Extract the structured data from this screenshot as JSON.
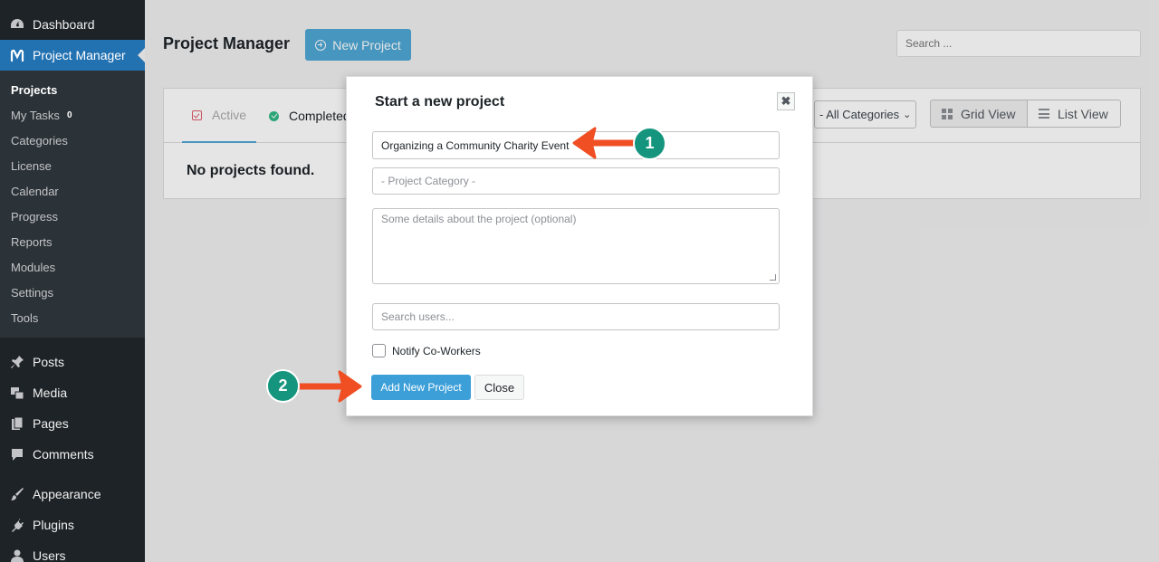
{
  "sidebar": {
    "top": [
      {
        "label": "Dashboard",
        "icon": "dashboard-icon"
      },
      {
        "label": "Project Manager",
        "icon": "project-manager-icon"
      }
    ],
    "submenu": [
      {
        "label": "Projects"
      },
      {
        "label": "My Tasks",
        "badge": "0"
      },
      {
        "label": "Categories"
      },
      {
        "label": "License"
      },
      {
        "label": "Calendar"
      },
      {
        "label": "Progress"
      },
      {
        "label": "Reports"
      },
      {
        "label": "Modules"
      },
      {
        "label": "Settings"
      },
      {
        "label": "Tools"
      }
    ],
    "group2": [
      {
        "label": "Posts",
        "icon": "pin-icon"
      },
      {
        "label": "Media",
        "icon": "media-icon"
      },
      {
        "label": "Pages",
        "icon": "pages-icon"
      },
      {
        "label": "Comments",
        "icon": "comments-icon"
      }
    ],
    "group3": [
      {
        "label": "Appearance",
        "icon": "brush-icon"
      },
      {
        "label": "Plugins",
        "icon": "plugin-icon"
      },
      {
        "label": "Users",
        "icon": "users-icon"
      }
    ]
  },
  "header": {
    "title": "Project Manager",
    "new_project_label": "New Project",
    "search_placeholder": "Search ..."
  },
  "panel": {
    "tabs": [
      {
        "label": "Active"
      },
      {
        "label": "Completed"
      }
    ],
    "category_filter": "- All Categories",
    "grid_view_label": "Grid View",
    "list_view_label": "List View",
    "empty_message": "No projects found."
  },
  "modal": {
    "title": "Start a new project",
    "project_name_value": "Organizing a Community Charity Event",
    "category_placeholder": "- Project Category -",
    "description_placeholder": "Some details about the project (optional)",
    "users_placeholder": "Search users...",
    "notify_label": "Notify Co-Workers",
    "add_button_label": "Add New Project",
    "close_button_label": "Close"
  },
  "annotations": [
    {
      "number": "1"
    },
    {
      "number": "2"
    }
  ],
  "colors": {
    "sidebar_bg": "#1d2327",
    "sidebar_active": "#2271b1",
    "primary_button": "#4fa8d5",
    "annotation_circle": "#15957e",
    "annotation_arrow": "#f04e23"
  }
}
